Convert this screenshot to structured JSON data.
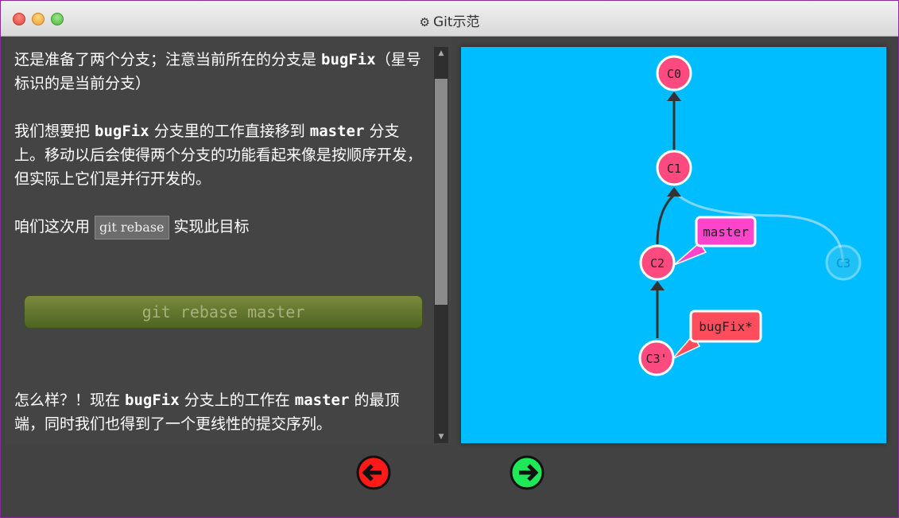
{
  "window": {
    "title": "Git示范"
  },
  "dialog": {
    "p1": "还是准备了两个分支；注意当前所在的分支是 ",
    "p1_code": "bugFix",
    "p1_tail": "（星号标识的是当前分支）",
    "p2a": "我们想要把 ",
    "p2_code1": "bugFix",
    "p2b": " 分支里的工作直接移到 ",
    "p2_code2": "master",
    "p2c": " 分支上。移动以后会使得两个分支的功能看起来像是按顺序开发，但实际上它们是并行开发的。",
    "p3a": "咱们这次用 ",
    "p3_cmd": "git rebase",
    "p3b": " 实现此目标",
    "run_button": "git rebase master",
    "p4a": "怎么样？！现在 ",
    "p4_code1": "bugFix",
    "p4b": " 分支上的工作在 ",
    "p4_code2": "master",
    "p4c": " 的最顶端，同时我们也得到了一个更线性的提交序列。"
  },
  "graph": {
    "commits": [
      "C0",
      "C1",
      "C2",
      "C3",
      "C3'"
    ],
    "branches": [
      {
        "name": "master",
        "color": "#ff44cc"
      },
      {
        "name": "bugFix*",
        "color": "#ff4d5e"
      }
    ],
    "colors": {
      "background": "#00bdff",
      "commit": "#ff4a7f",
      "commit_faded": "#39c6ef"
    }
  },
  "nav": {
    "back_icon": "arrow-left-icon",
    "forward_icon": "arrow-right-icon"
  }
}
